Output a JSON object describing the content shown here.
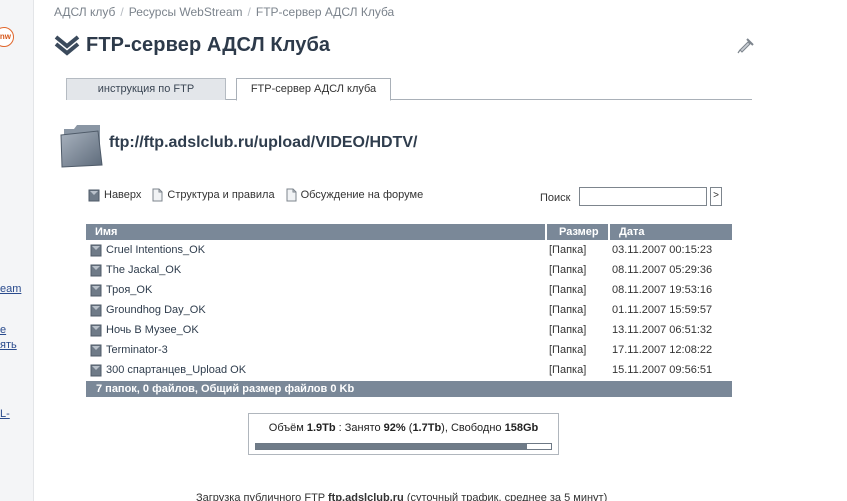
{
  "sidebar": {
    "badge": "nw",
    "items": [
      "eam",
      "е",
      "ять",
      "L-"
    ]
  },
  "breadcrumb": {
    "items": [
      "АДСЛ клуб",
      "Ресурсы WebStream",
      "FTP-сервер АДСЛ Клуба"
    ],
    "separator": "/"
  },
  "header": {
    "title": "FTP-сервер АДСЛ Клуба"
  },
  "tabs": [
    {
      "label": "инструкция по FTP",
      "active": false
    },
    {
      "label": "FTP-сервер АДСЛ клуба",
      "active": true
    }
  ],
  "location": {
    "path": "ftp://ftp.adslclub.ru/upload/VIDEO/HDTV/"
  },
  "toolbar": {
    "up_label": "Наверх",
    "structure_label": "Структура и правила",
    "forum_label": "Обсуждение на форуме"
  },
  "search": {
    "label": "Поиск",
    "value": "",
    "button_label": ">"
  },
  "table": {
    "headers": {
      "name": "Имя",
      "size": "Размер",
      "date": "Дата"
    },
    "rows": [
      {
        "name": "Cruel Intentions_OK",
        "size": "[Папка]",
        "date": "03.11.2007 00:15:23"
      },
      {
        "name": "The Jackal_OK",
        "size": "[Папка]",
        "date": "08.11.2007 05:29:36"
      },
      {
        "name": "Троя_OK",
        "size": "[Папка]",
        "date": "08.11.2007 19:53:16"
      },
      {
        "name": "Groundhog Day_OK",
        "size": "[Папка]",
        "date": "01.11.2007 15:59:57"
      },
      {
        "name": "Ночь В Музее_OK",
        "size": "[Папка]",
        "date": "13.11.2007 06:51:32"
      },
      {
        "name": "Terminator-3",
        "size": "[Папка]",
        "date": "17.11.2007 12:08:22"
      },
      {
        "name": "300 спартанцев_Upload OK",
        "size": "[Папка]",
        "date": "15.11.2007 09:56:51"
      }
    ],
    "summary": "7 папок, 0 файлов, Общий размер файлов 0 Kb"
  },
  "storage": {
    "volume_label": "Объём",
    "volume": "1.9Tb",
    "used_label": "Занято",
    "used_percent": "92%",
    "used_amount": "1.7Tb",
    "free_label": "Свободно",
    "free": "158Gb",
    "fill_fraction": 0.92
  },
  "footer": {
    "prefix": "Загрузка публичного FTP",
    "host": "ftp.adslclub.ru",
    "suffix": "(суточный трафик, среднее за 5 минут)"
  },
  "colors": {
    "header_bg": "#7a8898",
    "title": "#2d3a4a",
    "accent_badge": "#e0662c"
  }
}
